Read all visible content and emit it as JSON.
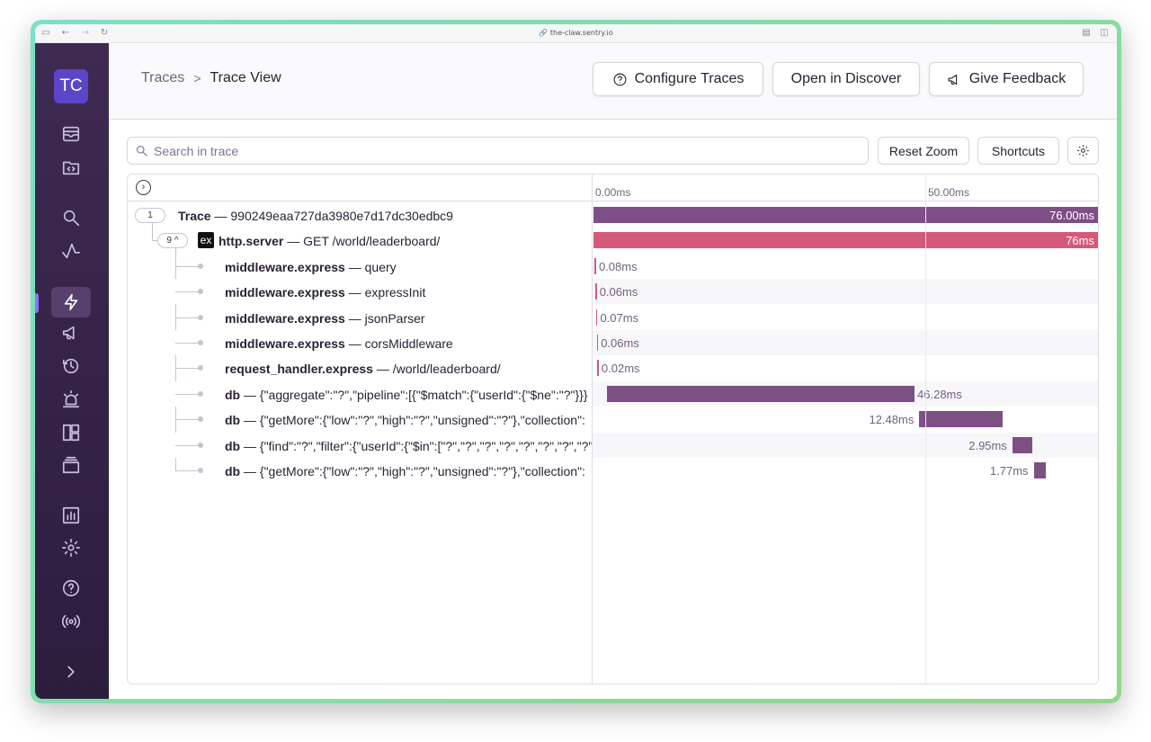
{
  "browser": {
    "url": "the-claw.sentry.io"
  },
  "sidebar": {
    "avatar": "TC",
    "items": [
      {
        "icon": "issues-icon"
      },
      {
        "icon": "projects-icon"
      },
      {
        "icon": "search-icon"
      },
      {
        "icon": "performance-icon"
      },
      {
        "icon": "traces-icon",
        "active": true
      },
      {
        "icon": "releases-icon"
      },
      {
        "icon": "history-icon"
      },
      {
        "icon": "alerts-icon"
      },
      {
        "icon": "dashboards-icon"
      },
      {
        "icon": "stack-icon"
      },
      {
        "icon": "stats-icon"
      },
      {
        "icon": "settings-icon"
      },
      {
        "icon": "help-icon"
      },
      {
        "icon": "broadcast-icon"
      },
      {
        "icon": "collapse-chevron-icon"
      }
    ],
    "accent": "#8e72ff"
  },
  "header": {
    "breadcrumb": {
      "parent": "Traces",
      "separator": ">",
      "current": "Trace View"
    },
    "buttons": {
      "configure": "Configure Traces",
      "discover": "Open in Discover",
      "feedback": "Give Feedback"
    }
  },
  "toolbar": {
    "search_placeholder": "Search in trace",
    "reset_zoom": "Reset Zoom",
    "shortcuts": "Shortcuts"
  },
  "timeline": {
    "ticks": [
      "0.00ms",
      "50.00ms"
    ],
    "total_ms": 76
  },
  "trace": {
    "root": {
      "count": "1",
      "op": "Trace",
      "desc": "990249eaa727da3980e7d17dc30edbc9",
      "duration": "76.00ms",
      "color": "#7e4f85"
    },
    "server": {
      "count": "9",
      "caret": "^",
      "icon_text": "ex",
      "op": "http.server",
      "desc": "GET /world/leaderboard/",
      "duration": "76ms",
      "color": "#d4597a"
    },
    "spans": [
      {
        "op": "middleware.express",
        "desc": "query",
        "duration": "0.08ms",
        "start": 0.2,
        "value": 0.08,
        "label_side": "right"
      },
      {
        "op": "middleware.express",
        "desc": "expressInit",
        "duration": "0.06ms",
        "start": 0.3,
        "value": 0.06,
        "label_side": "right"
      },
      {
        "op": "middleware.express",
        "desc": "jsonParser",
        "duration": "0.07ms",
        "start": 0.4,
        "value": 0.07,
        "label_side": "right"
      },
      {
        "op": "middleware.express",
        "desc": "corsMiddleware",
        "duration": "0.06ms",
        "start": 0.5,
        "value": 0.06,
        "label_side": "right"
      },
      {
        "op": "request_handler.express",
        "desc": "/world/leaderboard/",
        "duration": "0.02ms",
        "start": 0.6,
        "value": 0.02,
        "label_side": "right"
      },
      {
        "op": "db",
        "desc": "{\"aggregate\":\"?\",\"pipeline\":[{\"$match\":{\"userId\":{\"$ne\":\"?\"}}}",
        "duration": "46.28ms",
        "start": 2.0,
        "value": 46.28,
        "label_side": "right"
      },
      {
        "op": "db",
        "desc": "{\"getMore\":{\"low\":\"?\",\"high\":\"?\",\"unsigned\":\"?\"},\"collection\":",
        "duration": "12.48ms",
        "start": 49.0,
        "value": 12.48,
        "label_side": "left"
      },
      {
        "op": "db",
        "desc": "{\"find\":\"?\",\"filter\":{\"userId\":{\"$in\":[\"?\",\"?\",\"?\",\"?\",\"?\",\"?\",\"?\",\"?\",\"",
        "duration": "2.95ms",
        "start": 63.0,
        "value": 2.95,
        "label_side": "left"
      },
      {
        "op": "db",
        "desc": "{\"getMore\":{\"low\":\"?\",\"high\":\"?\",\"unsigned\":\"?\"},\"collection\":",
        "duration": "1.77ms",
        "start": 66.2,
        "value": 1.77,
        "label_side": "left"
      }
    ],
    "span_color": "#7e4f85",
    "tick_color": "#d4597a"
  }
}
